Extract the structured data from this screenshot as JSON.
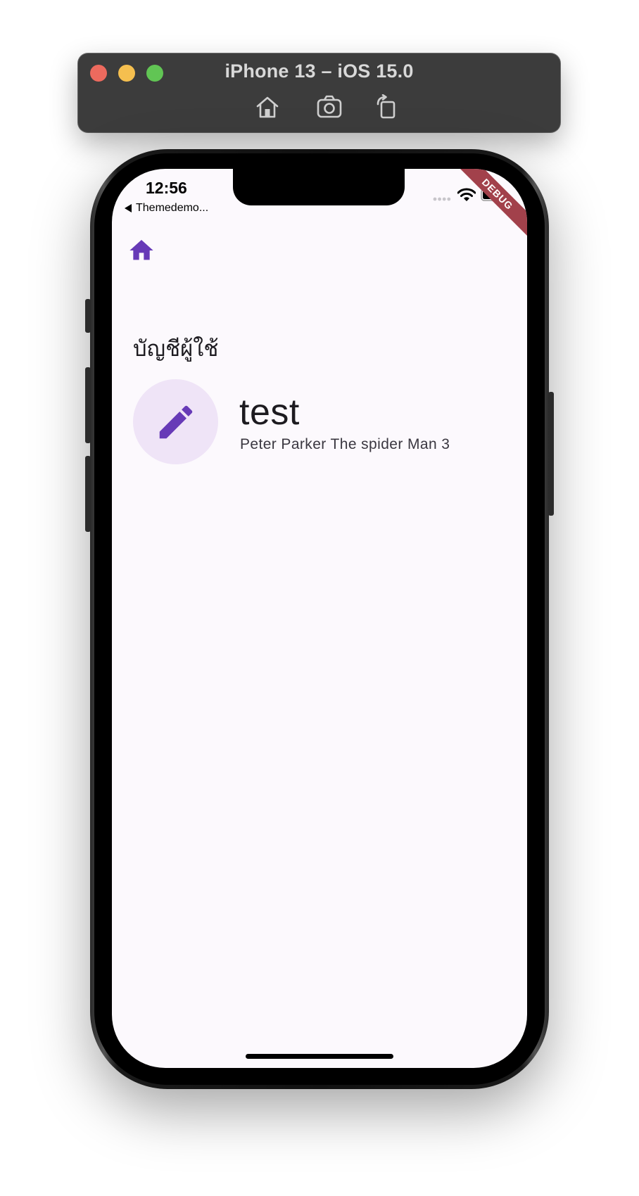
{
  "simulator": {
    "title": "iPhone 13 – iOS 15.0",
    "tools": [
      "home-icon",
      "screenshot-icon",
      "rotate-icon"
    ]
  },
  "status_bar": {
    "time": "12:56",
    "back_app": "Themedemo...",
    "debug_banner": "DEBUG"
  },
  "app": {
    "nav_icon": "home-icon",
    "section_title": "บัญชีผู้ใช้",
    "account": {
      "icon": "edit-pencil-icon",
      "name": "test",
      "subtitle": "Peter Parker The spider Man 3"
    }
  },
  "colors": {
    "accent": "#673ab7",
    "avatar_bg": "#efe4f7",
    "screen_bg": "#fcf9fd",
    "debug_ribbon": "#a2414b"
  }
}
